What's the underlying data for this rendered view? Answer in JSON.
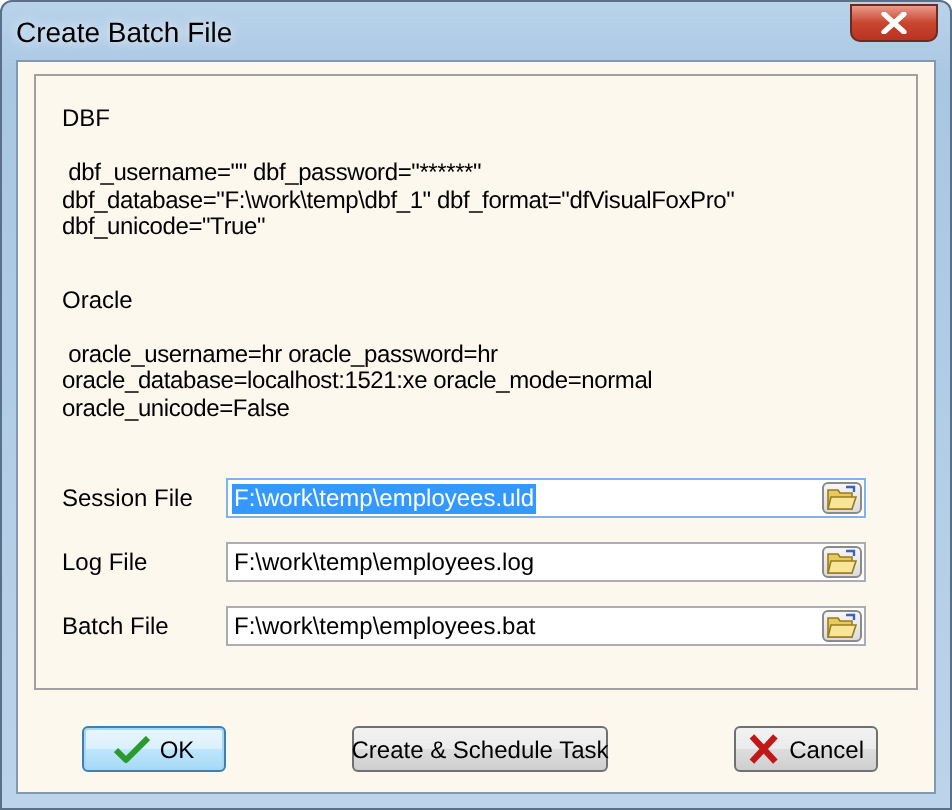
{
  "window": {
    "title": "Create Batch File"
  },
  "sections": [
    {
      "heading": "DBF",
      "lines": [
        " dbf_username=\"\" dbf_password=\"******\"",
        "dbf_database=\"F:\\work\\temp\\dbf_1\" dbf_format=\"dfVisualFoxPro\"",
        "dbf_unicode=\"True\""
      ]
    },
    {
      "heading": "Oracle",
      "lines": [
        " oracle_username=hr oracle_password=hr",
        "oracle_database=localhost:1521:xe oracle_mode=normal",
        "oracle_unicode=False"
      ]
    }
  ],
  "fields": [
    {
      "label": "Session File",
      "value": "F:\\work\\temp\\employees.uld",
      "text_selected": true
    },
    {
      "label": "Log File",
      "value": "F:\\work\\temp\\employees.log",
      "text_selected": false
    },
    {
      "label": "Batch File",
      "value": "F:\\work\\temp\\employees.bat",
      "text_selected": false
    }
  ],
  "buttons": [
    {
      "label": "OK",
      "kind": "ok",
      "focused": true
    },
    {
      "label": "Create & Schedule Task",
      "kind": "plain",
      "focused": false
    },
    {
      "label": "Cancel",
      "kind": "cancel",
      "focused": false
    }
  ]
}
